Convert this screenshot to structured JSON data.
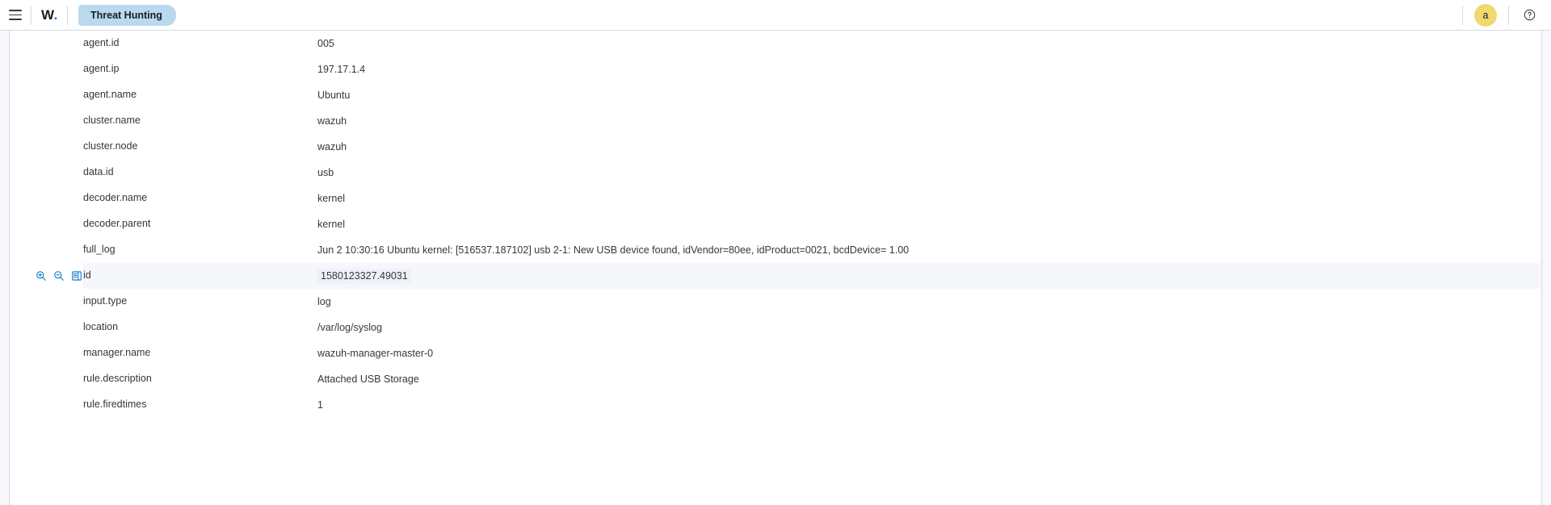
{
  "nav": {
    "menu_icon": "hamburger-menu-icon",
    "logo_text": "W",
    "logo_dot": ".",
    "tab_label": "Threat Hunting",
    "avatar_initial": "a",
    "help_icon": "question-circle-icon"
  },
  "row_actions": {
    "zoom_in": "magnifier-plus-icon",
    "zoom_out": "magnifier-minus-icon",
    "toggle_column": "toggle-column-icon"
  },
  "document": {
    "hovered_field": "id",
    "rows": [
      {
        "field": "agent.id",
        "value": "005"
      },
      {
        "field": "agent.ip",
        "value": "197.17.1.4"
      },
      {
        "field": "agent.name",
        "value": "Ubuntu"
      },
      {
        "field": "cluster.name",
        "value": "wazuh"
      },
      {
        "field": "cluster.node",
        "value": "wazuh"
      },
      {
        "field": "data.id",
        "value": "usb"
      },
      {
        "field": "decoder.name",
        "value": "kernel"
      },
      {
        "field": "decoder.parent",
        "value": "kernel"
      },
      {
        "field": "full_log",
        "value": "Jun 2 10:30:16 Ubuntu kernel: [516537.187102] usb 2-1: New USB device found, idVendor=80ee, idProduct=0021, bcdDevice= 1.00"
      },
      {
        "field": "id",
        "value": "1580123327.49031"
      },
      {
        "field": "input.type",
        "value": "log"
      },
      {
        "field": "location",
        "value": "/var/log/syslog"
      },
      {
        "field": "manager.name",
        "value": "wazuh-manager-master-0"
      },
      {
        "field": "rule.description",
        "value": "Attached USB Storage"
      },
      {
        "field": "rule.firedtimes",
        "value": "1"
      }
    ]
  }
}
